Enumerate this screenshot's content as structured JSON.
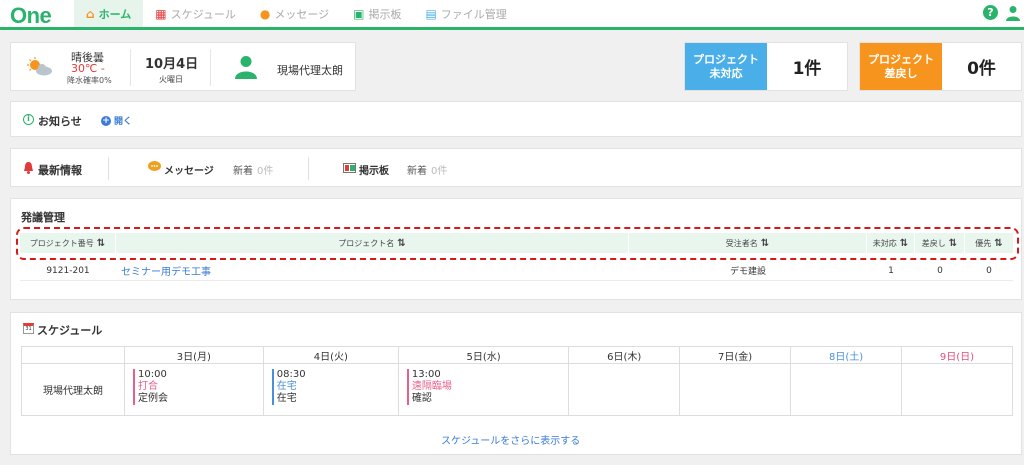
{
  "app": {
    "logo": "One"
  },
  "nav": {
    "items": [
      {
        "label": "ホーム",
        "icon": "house-icon",
        "active": true
      },
      {
        "label": "スケジュール",
        "icon": "calendar-icon",
        "active": false
      },
      {
        "label": "メッセージ",
        "icon": "chat-icon",
        "active": false
      },
      {
        "label": "掲示板",
        "icon": "board-icon",
        "active": false
      },
      {
        "label": "ファイル管理",
        "icon": "file-icon",
        "active": false
      }
    ],
    "help_glyph": "?"
  },
  "profile": {
    "weather": "晴後曇",
    "temp": "30℃ -",
    "rain": "降水確率0%",
    "date": "10月4日",
    "weekday": "火曜日",
    "user_name": "現場代理太朗"
  },
  "badges": [
    {
      "label_line1": "プロジェクト",
      "label_line2": "未対応",
      "count": "1件",
      "color": "#4aaee8"
    },
    {
      "label_line1": "プロジェクト",
      "label_line2": "差戻し",
      "count": "0件",
      "color": "#f7941d"
    }
  ],
  "notice": {
    "title": "お知らせ",
    "open_label": "開く",
    "info_glyph": "i",
    "plus_glyph": "+"
  },
  "latest": {
    "title": "最新情報",
    "message_label": "メッセージ",
    "message_new_label": "新着",
    "message_new_count": "0件",
    "board_label": "掲示板",
    "board_new_label": "新着",
    "board_new_count": "0件"
  },
  "orders": {
    "title": "発議管理",
    "sort_glyph": "⇅",
    "columns": [
      "プロジェクト番号",
      "プロジェクト名",
      "受注者名",
      "未対応",
      "差戻し",
      "優先"
    ],
    "rows": [
      {
        "number": "9121-201",
        "name": "セミナー用デモ工事",
        "contractor": "デモ建設",
        "pending": "1",
        "returned": "0",
        "priority": "0"
      }
    ]
  },
  "schedule": {
    "title": "スケジュール",
    "calendar_glyph": "31",
    "days": [
      {
        "label": "3日(月)",
        "color": "#333333"
      },
      {
        "label": "4日(火)",
        "color": "#333333"
      },
      {
        "label": "5日(水)",
        "color": "#333333"
      },
      {
        "label": "6日(木)",
        "color": "#333333"
      },
      {
        "label": "7日(金)",
        "color": "#333333"
      },
      {
        "label": "8日(土)",
        "color": "#4a90d9"
      },
      {
        "label": "9日(日)",
        "color": "#e0507a"
      }
    ],
    "row_user": "現場代理太朗",
    "events": [
      {
        "time": "10:00",
        "category": "打合",
        "detail": "定例会",
        "color": "#e8608a"
      },
      {
        "time": "08:30",
        "category": "在宅",
        "detail": "在宅",
        "color": "#4a90d9"
      },
      {
        "time": "13:00",
        "category": "遠隔臨場",
        "detail": "確認",
        "color": "#e8608a"
      }
    ],
    "more_link": "スケジュールをさらに表示する"
  }
}
